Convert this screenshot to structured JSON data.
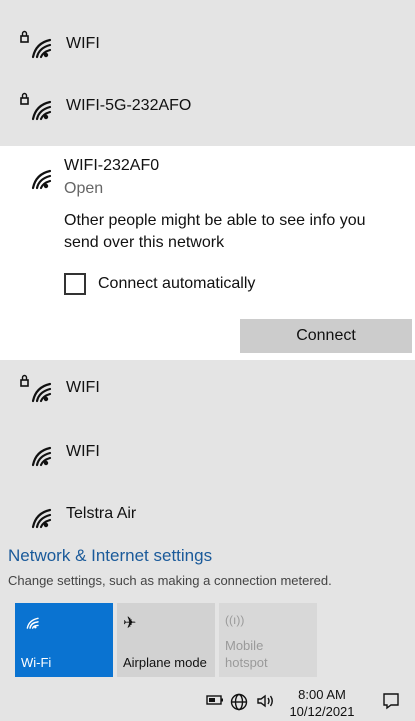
{
  "networks_top": [
    {
      "name": "WIFI",
      "secured": true
    },
    {
      "name": "WIFI-5G-232AFO",
      "secured": true
    }
  ],
  "expanded": {
    "name": "WIFI-232AF0",
    "status": "Open",
    "warning": "Other people might be able to see info you send over this network",
    "checkbox_label": "Connect automatically",
    "checked": false,
    "connect_label": "Connect"
  },
  "networks_bottom": [
    {
      "name": "WIFI",
      "secured": true
    },
    {
      "name": "WIFI",
      "secured": false
    },
    {
      "name": "Telstra Air",
      "secured": false
    }
  ],
  "settings": {
    "link": "Network & Internet settings",
    "sub": "Change settings, such as making a connection metered."
  },
  "tiles": {
    "wifi": {
      "label": "Wi-Fi",
      "icon": "wifi-icon",
      "active": true
    },
    "airplane": {
      "label": "Airplane mode",
      "icon": "airplane-icon",
      "active": false
    },
    "hotspot": {
      "label1": "Mobile",
      "label2": "hotspot",
      "icon": "hotspot-icon",
      "active": false,
      "disabled": true
    }
  },
  "taskbar": {
    "time": "8:00 AM",
    "date": "10/12/2021",
    "icons": [
      "battery-icon",
      "globe-icon",
      "speaker-icon",
      "notifications-icon"
    ]
  },
  "colors": {
    "accent": "#0a73d1",
    "link": "#1a5a9a",
    "panel_bg": "#e4e4e4",
    "expanded_bg": "#ffffff"
  }
}
